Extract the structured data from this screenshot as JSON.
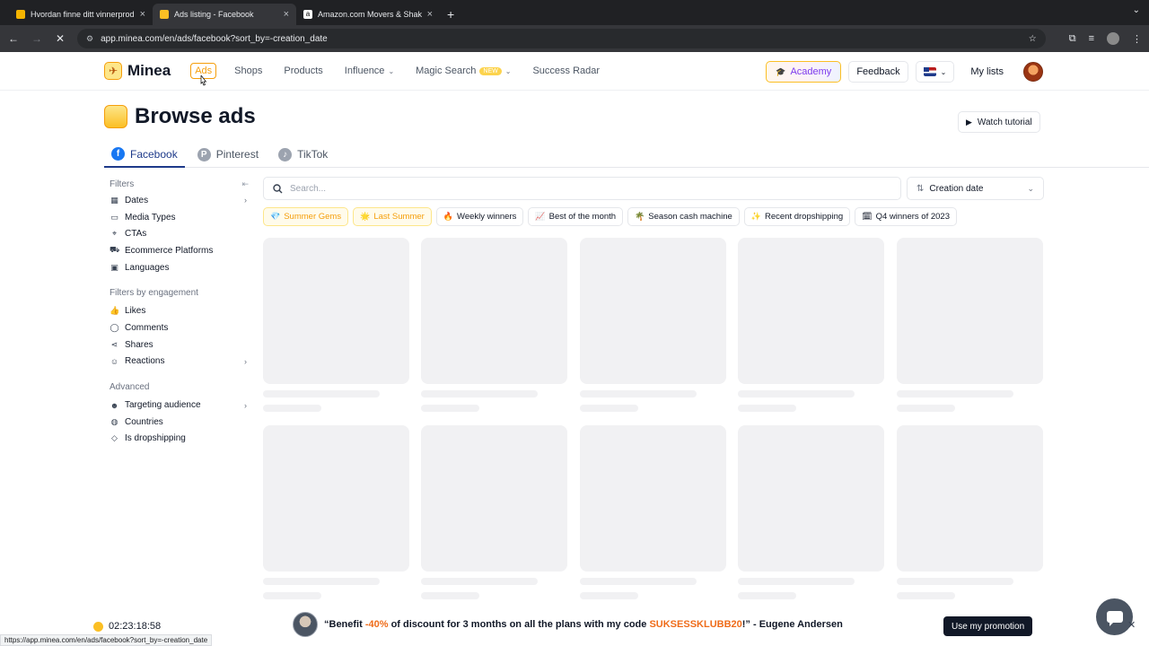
{
  "browser": {
    "tabs": [
      {
        "title": "Hvordan finne ditt vinnerprodukt",
        "favicon_color": "#f4b400",
        "active": false
      },
      {
        "title": "Ads listing - Facebook",
        "favicon_color": "#fbbf24",
        "active": true
      },
      {
        "title": "Amazon.com Movers & Shakers",
        "favicon_color": "#ffffff",
        "active": false
      }
    ],
    "new_tab": "+",
    "url": "app.minea.com/en/ads/facebook?sort_by=-creation_date",
    "status_url": "https://app.minea.com/en/ads/facebook?sort_by=-creation_date"
  },
  "header": {
    "logo": "Minea",
    "nav": [
      {
        "label": "Ads",
        "active": true
      },
      {
        "label": "Shops"
      },
      {
        "label": "Products"
      },
      {
        "label": "Influence",
        "dropdown": true
      },
      {
        "label": "Magic Search",
        "badge": "NEW",
        "dropdown": true
      },
      {
        "label": "Success Radar"
      }
    ],
    "academy": "Academy",
    "feedback": "Feedback",
    "my_lists": "My lists"
  },
  "page": {
    "title": "Browse ads",
    "watch_tutorial": "Watch tutorial",
    "platforms": [
      {
        "label": "Facebook",
        "icon": "facebook-icon",
        "color": "#1877f2",
        "active": true
      },
      {
        "label": "Pinterest",
        "icon": "pinterest-icon",
        "color": "#9ca3af"
      },
      {
        "label": "TikTok",
        "icon": "tiktok-icon",
        "color": "#9ca3af"
      }
    ]
  },
  "sidebar": {
    "filters_title": "Filters",
    "filters": [
      {
        "label": "Dates",
        "icon": "calendar-icon",
        "arrow": true
      },
      {
        "label": "Media Types",
        "icon": "media-icon"
      },
      {
        "label": "CTAs",
        "icon": "cta-icon"
      },
      {
        "label": "Ecommerce Platforms",
        "icon": "cart-icon"
      },
      {
        "label": "Languages",
        "icon": "language-icon"
      }
    ],
    "engagement_title": "Filters by engagement",
    "engagement": [
      {
        "label": "Likes",
        "icon": "thumbs-up-icon"
      },
      {
        "label": "Comments",
        "icon": "comment-icon"
      },
      {
        "label": "Shares",
        "icon": "share-icon"
      },
      {
        "label": "Reactions",
        "icon": "smile-icon",
        "arrow": true
      }
    ],
    "advanced_title": "Advanced",
    "advanced": [
      {
        "label": "Targeting audience",
        "icon": "user-icon",
        "arrow": true
      },
      {
        "label": "Countries",
        "icon": "globe-icon"
      },
      {
        "label": "Is dropshipping",
        "icon": "tag-icon"
      }
    ]
  },
  "search": {
    "placeholder": "Search..."
  },
  "sort": {
    "label": "Creation date"
  },
  "chips": [
    {
      "label": "Summer Gems",
      "emoji": "💎",
      "highlight": true
    },
    {
      "label": "Last Summer",
      "emoji": "🌟",
      "highlight": true
    },
    {
      "label": "Weekly winners",
      "emoji": "🔥"
    },
    {
      "label": "Best of the month",
      "emoji": "📈"
    },
    {
      "label": "Season cash machine",
      "emoji": "🌴"
    },
    {
      "label": "Recent dropshipping",
      "emoji": "✨"
    },
    {
      "label": "Q4 winners of 2023",
      "emoji": "🗓"
    }
  ],
  "promo": {
    "timer": "02:23:18:58",
    "text_before": "“Benefit ",
    "discount": "-40%",
    "text_middle": " of discount for 3 months on all the plans with my code ",
    "code": "SUKSESSKLUBB20",
    "text_after": "!” - Eugene Andersen",
    "button": "Use my promotion"
  }
}
